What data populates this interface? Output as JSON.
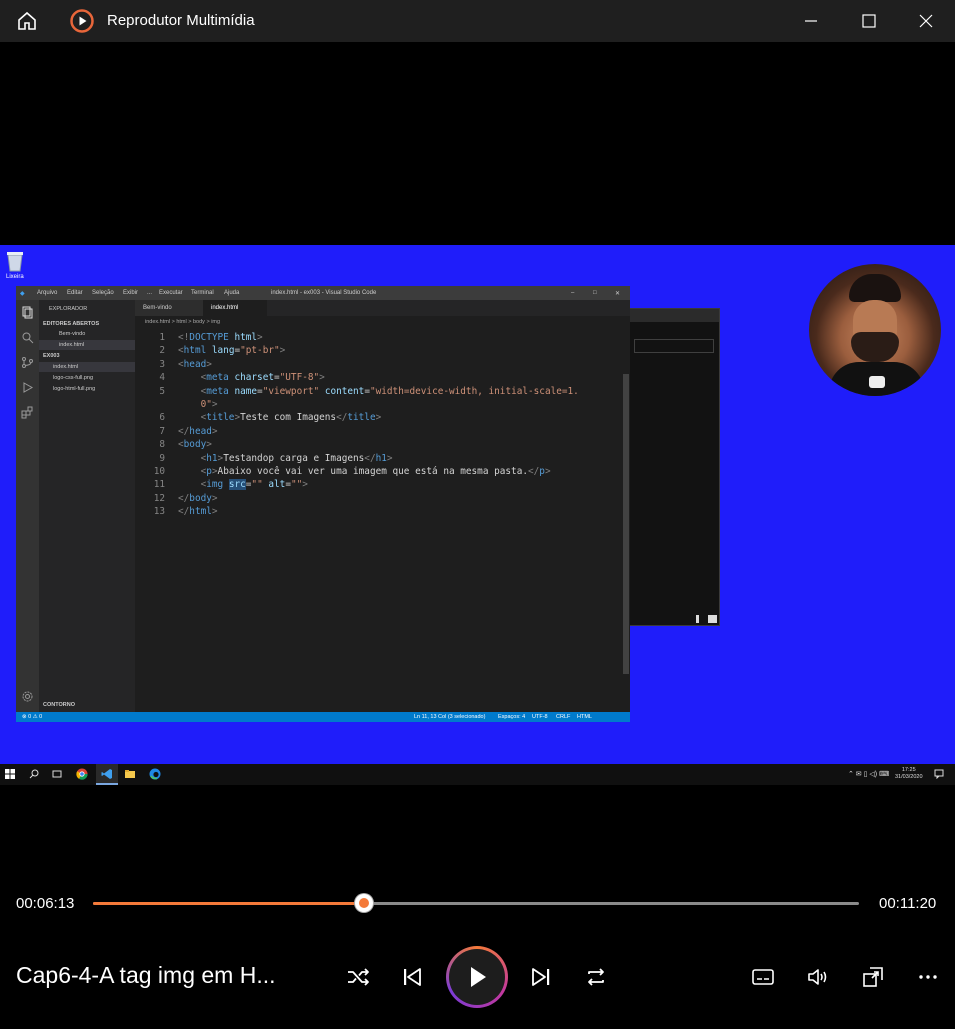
{
  "window": {
    "title": "Reprodutor Multimídia"
  },
  "desktop": {
    "recycle_label": "Lixeira"
  },
  "vscode": {
    "menu": [
      "Arquivo",
      "Editar",
      "Seleção",
      "Exibir",
      "...",
      "Executar",
      "Terminal",
      "Ajuda"
    ],
    "window_title": "index.html - ex003 - Visual Studio Code",
    "sidebar": {
      "header": "EXPLORADOR",
      "open_editors": "EDITORES ABERTOS",
      "open_items": [
        "Bem-vindo",
        "index.html"
      ],
      "folder": "EX003",
      "files": [
        "index.html",
        "logo-css-full.png",
        "logo-html-full.png"
      ],
      "outline": "CONTORNO"
    },
    "tabs": [
      "Bem-vindo",
      "index.html"
    ],
    "breadcrumb": "index.html > html > body > img",
    "code_lines": [
      {
        "n": "1",
        "html": "<span class='p'>&lt;!</span><span class='t'>DOCTYPE</span> <span class='a'>html</span><span class='p'>&gt;</span>"
      },
      {
        "n": "2",
        "html": "<span class='p'>&lt;</span><span class='t'>html</span> <span class='a'>lang</span>=<span class='s'>\"pt-br\"</span><span class='p'>&gt;</span>"
      },
      {
        "n": "3",
        "html": "<span class='p'>&lt;</span><span class='t'>head</span><span class='p'>&gt;</span>"
      },
      {
        "n": "4",
        "html": "    <span class='p'>&lt;</span><span class='t'>meta</span> <span class='a'>charset</span>=<span class='s'>\"UTF-8\"</span><span class='p'>&gt;</span>"
      },
      {
        "n": "5",
        "html": "    <span class='p'>&lt;</span><span class='t'>meta</span> <span class='a'>name</span>=<span class='s'>\"viewport\"</span> <span class='a'>content</span>=<span class='s'>\"width=device-width, initial-scale=1.</span>"
      },
      {
        "n": "",
        "html": "    <span class='s'>0\"</span><span class='p'>&gt;</span>"
      },
      {
        "n": "6",
        "html": "    <span class='p'>&lt;</span><span class='t'>title</span><span class='p'>&gt;</span>Teste com Imagens<span class='p'>&lt;/</span><span class='t'>title</span><span class='p'>&gt;</span>"
      },
      {
        "n": "7",
        "html": "<span class='p'>&lt;/</span><span class='t'>head</span><span class='p'>&gt;</span>"
      },
      {
        "n": "8",
        "html": "<span class='p'>&lt;</span><span class='t'>body</span><span class='p'>&gt;</span>"
      },
      {
        "n": "9",
        "html": "    <span class='p'>&lt;</span><span class='t'>h1</span><span class='p'>&gt;</span>Testandop carga e Imagens<span class='p'>&lt;/</span><span class='t'>h1</span><span class='p'>&gt;</span>"
      },
      {
        "n": "10",
        "html": "    <span class='p'>&lt;</span><span class='t'>p</span><span class='p'>&gt;</span>Abaixo você vai ver uma imagem que está na mesma pasta.<span class='p'>&lt;/</span><span class='t'>p</span><span class='p'>&gt;</span>"
      },
      {
        "n": "11",
        "html": "    <span class='p'>&lt;</span><span class='t'>img</span> <span class='a sel'>src</span>=<span class='s'>\"\"</span> <span class='a'>alt</span>=<span class='s'>\"\"</span><span class='p'>&gt;</span>"
      },
      {
        "n": "12",
        "html": "<span class='p'>&lt;/</span><span class='t'>body</span><span class='p'>&gt;</span>"
      },
      {
        "n": "13",
        "html": "<span class='p'>&lt;/</span><span class='t'>html</span><span class='p'>&gt;</span>"
      }
    ],
    "status": {
      "left": "⊗ 0 ⚠ 0",
      "position": "Ln 11, 13 Col (3 selecionado)",
      "spaces": "Espaços: 4",
      "encoding": "UTF-8",
      "eol": "CRLF",
      "language": "HTML"
    }
  },
  "taskbar": {
    "time": "17:25",
    "date": "31/03/2020"
  },
  "player": {
    "current_time": "00:06:13",
    "total_time": "00:11:20",
    "progress": 0.3533,
    "media_title": "Cap6-4-A tag img em H..."
  },
  "colors": {
    "accent": "#f47a3a",
    "desktop_blue": "#1f1dfa",
    "vscode_blue": "#007acc"
  }
}
